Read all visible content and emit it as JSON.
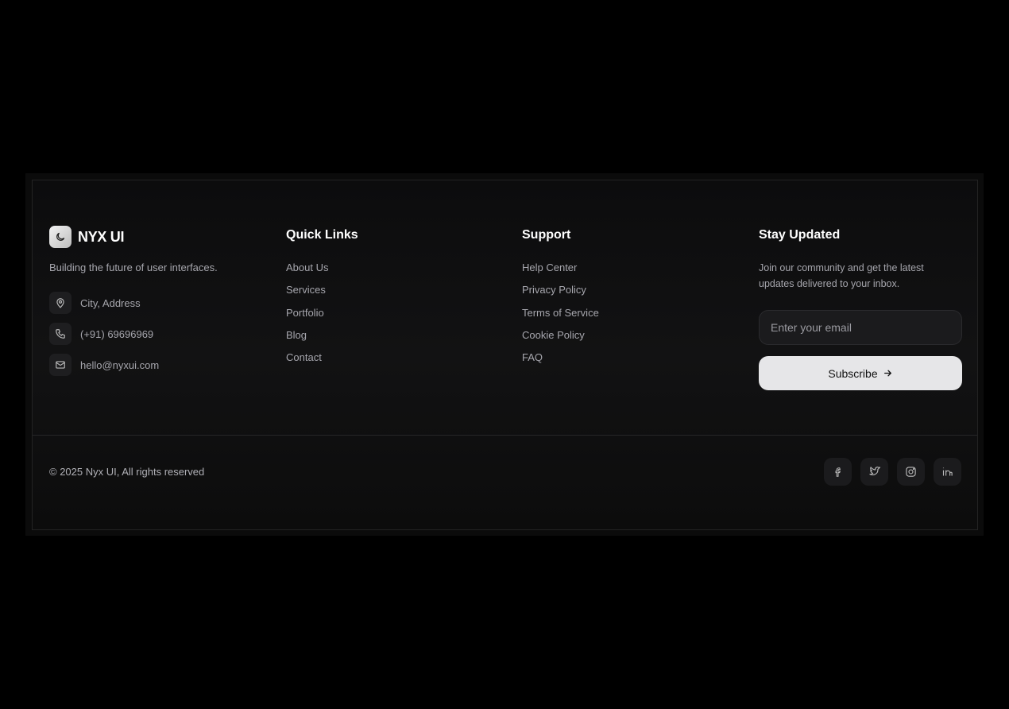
{
  "brand": {
    "name": "NYX UI",
    "tagline": "Building the future of user interfaces.",
    "logo_icon": "moon-icon"
  },
  "contacts": [
    {
      "icon": "map-pin-icon",
      "text": "City, Address"
    },
    {
      "icon": "phone-icon",
      "text": "(+91) 69696969"
    },
    {
      "icon": "mail-icon",
      "text": "hello@nyxui.com"
    }
  ],
  "quick_links": {
    "title": "Quick Links",
    "items": [
      "About Us",
      "Services",
      "Portfolio",
      "Blog",
      "Contact"
    ]
  },
  "support": {
    "title": "Support",
    "items": [
      "Help Center",
      "Privacy Policy",
      "Terms of Service",
      "Cookie Policy",
      "FAQ"
    ]
  },
  "newsletter": {
    "title": "Stay Updated",
    "description": "Join our community and get the latest updates delivered to your inbox.",
    "email_placeholder": "Enter your email",
    "email_value": "",
    "button_label": "Subscribe",
    "button_icon": "arrow-right-icon"
  },
  "footer": {
    "copyright": "© 2025 Nyx UI, All rights reserved",
    "socials": [
      "facebook-icon",
      "twitter-icon",
      "instagram-icon",
      "linkedin-icon"
    ]
  }
}
